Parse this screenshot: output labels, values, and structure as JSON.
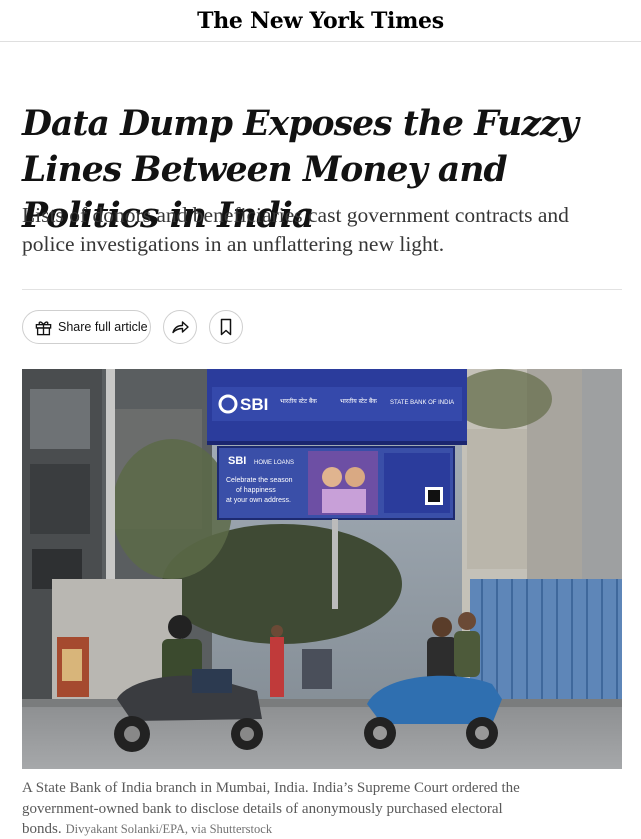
{
  "masthead": {
    "logo_text": "The New York Times"
  },
  "article": {
    "headline": "Data Dump Exposes the Fuzzy Lines Between Money and Politics in India",
    "summary": "Lists of donors and beneficiaries cast government contracts and police investigations in an unflattering new light."
  },
  "actions": {
    "share_label": "Share full article"
  },
  "photo": {
    "main_sign_brand": "SBI",
    "main_sign_hindi_1": "भारतीय स्टेट बैंक",
    "main_sign_hindi_2": "भारतीय स्टेट बैंक",
    "main_sign_english": "STATE BANK OF INDIA",
    "ad_brand": "SBI",
    "ad_product": "HOME LOANS",
    "ad_tagline_1": "Celebrate the season",
    "ad_tagline_2": "of happiness",
    "ad_tagline_3": "at your own address."
  },
  "caption": {
    "text": "A State Bank of India branch in Mumbai, India. India’s Supreme Court ordered the government-owned bank to disclose details of anonymously purchased electoral bonds.",
    "credit": "Divyakant Solanki/EPA, via Shutterstock"
  },
  "colors": {
    "sbi_blue": "#2b3c9c",
    "scooter_blue": "#2f6fb0",
    "text": "#121212"
  }
}
